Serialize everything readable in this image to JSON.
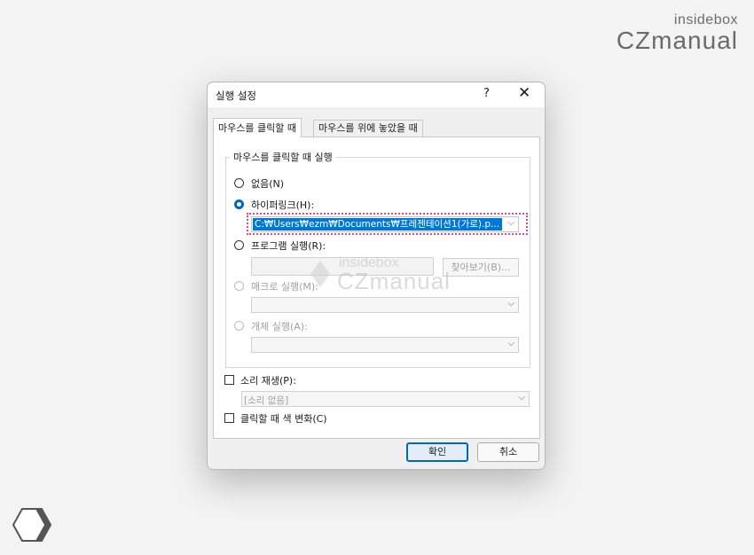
{
  "brand": {
    "small": "insidebox",
    "big": "CZmanual"
  },
  "watermark": {
    "small": "insidebox",
    "big": "CZmanual"
  },
  "dialog": {
    "title": "실행 설정",
    "help_glyph": "?",
    "close_glyph": "✕",
    "tabs": [
      {
        "label": "마우스를 클릭할 때",
        "active": true
      },
      {
        "label": "마우스를 위에 놓았을 때",
        "active": false
      }
    ],
    "group_label": "마우스를 클릭할 때 실행",
    "options": {
      "none": "없음(N)",
      "hyperlink": "하이퍼링크(H):",
      "hyperlink_value": "C:₩Users₩ezm₩Documents₩프레젠테이션1(가로).p...",
      "run_program": "프로그램 실행(R):",
      "browse": "찾아보기(B)...",
      "run_macro": "매크로 실행(M):",
      "object_action": "개체 실행(A):"
    },
    "play_sound": "소리 재생(P):",
    "sound_value": "[소리 없음]",
    "highlight_click": "클릭할 때 색 변화(C)",
    "ok": "확인",
    "cancel": "취소"
  },
  "colors": {
    "accent": "#0067c0",
    "highlight": "#0078d7",
    "focus_ring": "#e8458b"
  }
}
